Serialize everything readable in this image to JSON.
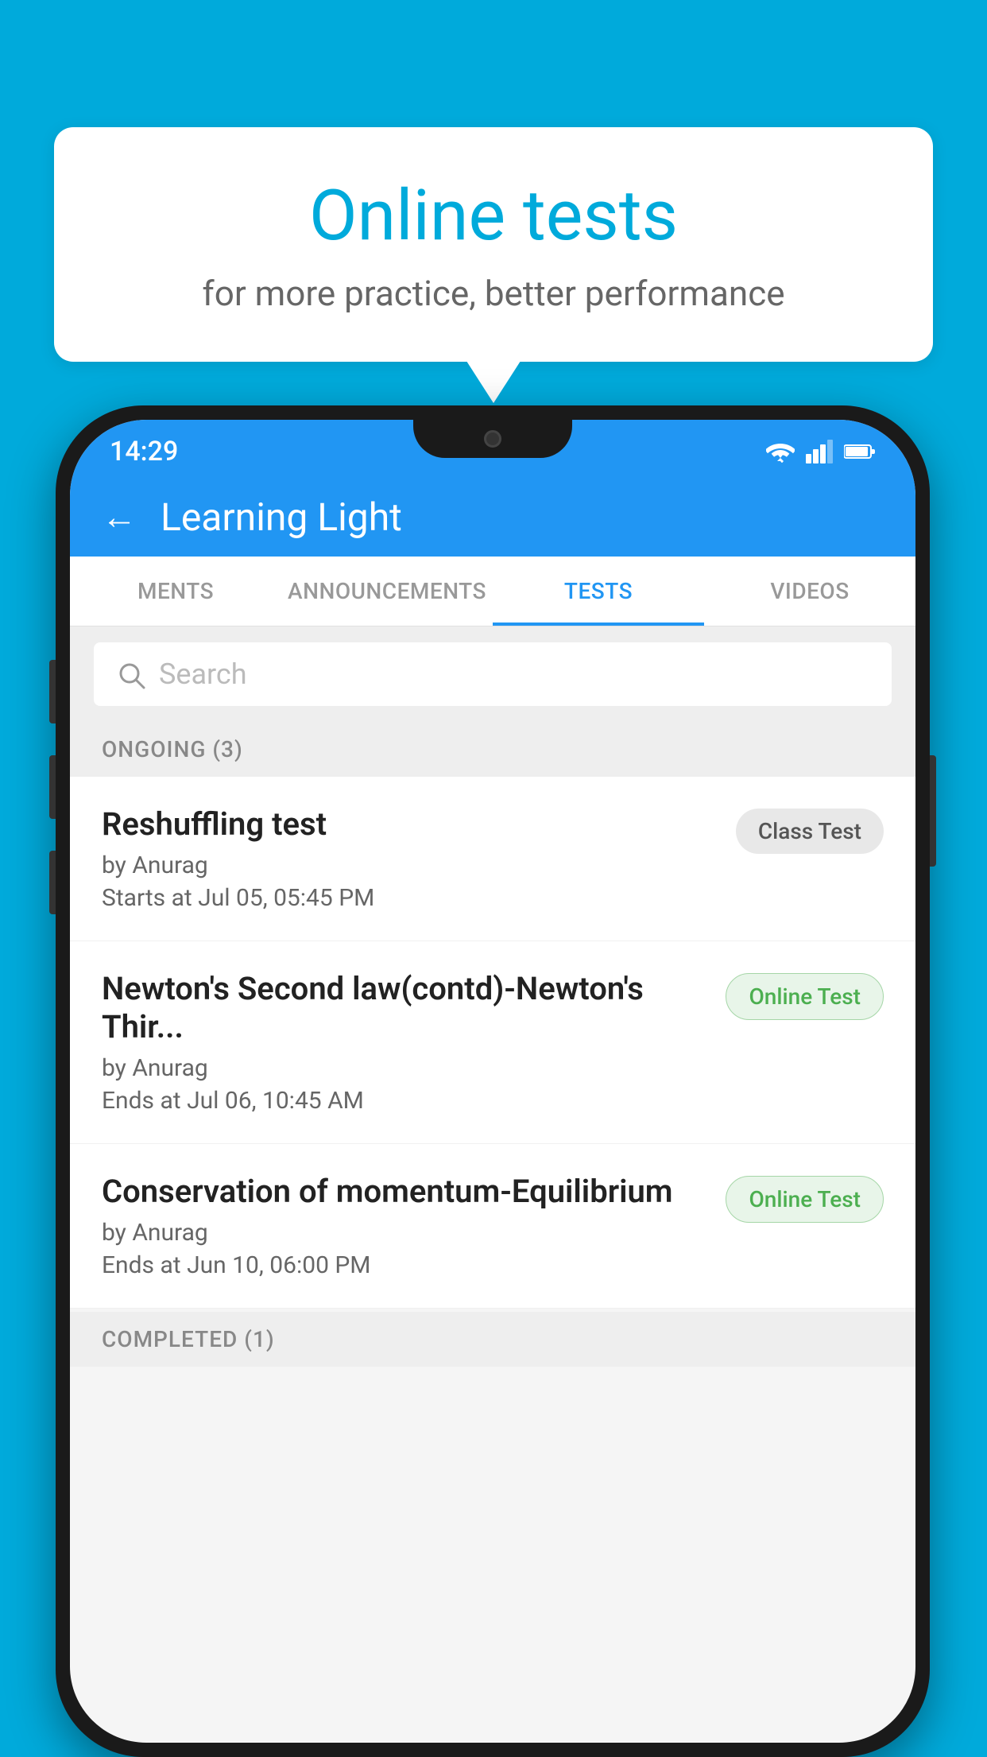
{
  "background_color": "#00AADB",
  "bubble": {
    "title": "Online tests",
    "subtitle": "for more practice, better performance"
  },
  "phone": {
    "status_bar": {
      "time": "14:29",
      "icons": [
        "wifi",
        "signal",
        "battery"
      ]
    },
    "header": {
      "title": "Learning Light",
      "back_label": "←"
    },
    "tabs": [
      {
        "label": "MENTS",
        "active": false
      },
      {
        "label": "ANNOUNCEMENTS",
        "active": false
      },
      {
        "label": "TESTS",
        "active": true
      },
      {
        "label": "VIDEOS",
        "active": false
      }
    ],
    "search": {
      "placeholder": "Search"
    },
    "ongoing_section": {
      "header": "ONGOING (3)",
      "tests": [
        {
          "name": "Reshuffling test",
          "author": "by Anurag",
          "time_label": "Starts at",
          "time": "Jul 05, 05:45 PM",
          "badge": "Class Test",
          "badge_type": "class"
        },
        {
          "name": "Newton's Second law(contd)-Newton's Thir...",
          "author": "by Anurag",
          "time_label": "Ends at",
          "time": "Jul 06, 10:45 AM",
          "badge": "Online Test",
          "badge_type": "online"
        },
        {
          "name": "Conservation of momentum-Equilibrium",
          "author": "by Anurag",
          "time_label": "Ends at",
          "time": "Jun 10, 06:00 PM",
          "badge": "Online Test",
          "badge_type": "online"
        }
      ]
    },
    "completed_section": {
      "header": "COMPLETED (1)"
    }
  }
}
